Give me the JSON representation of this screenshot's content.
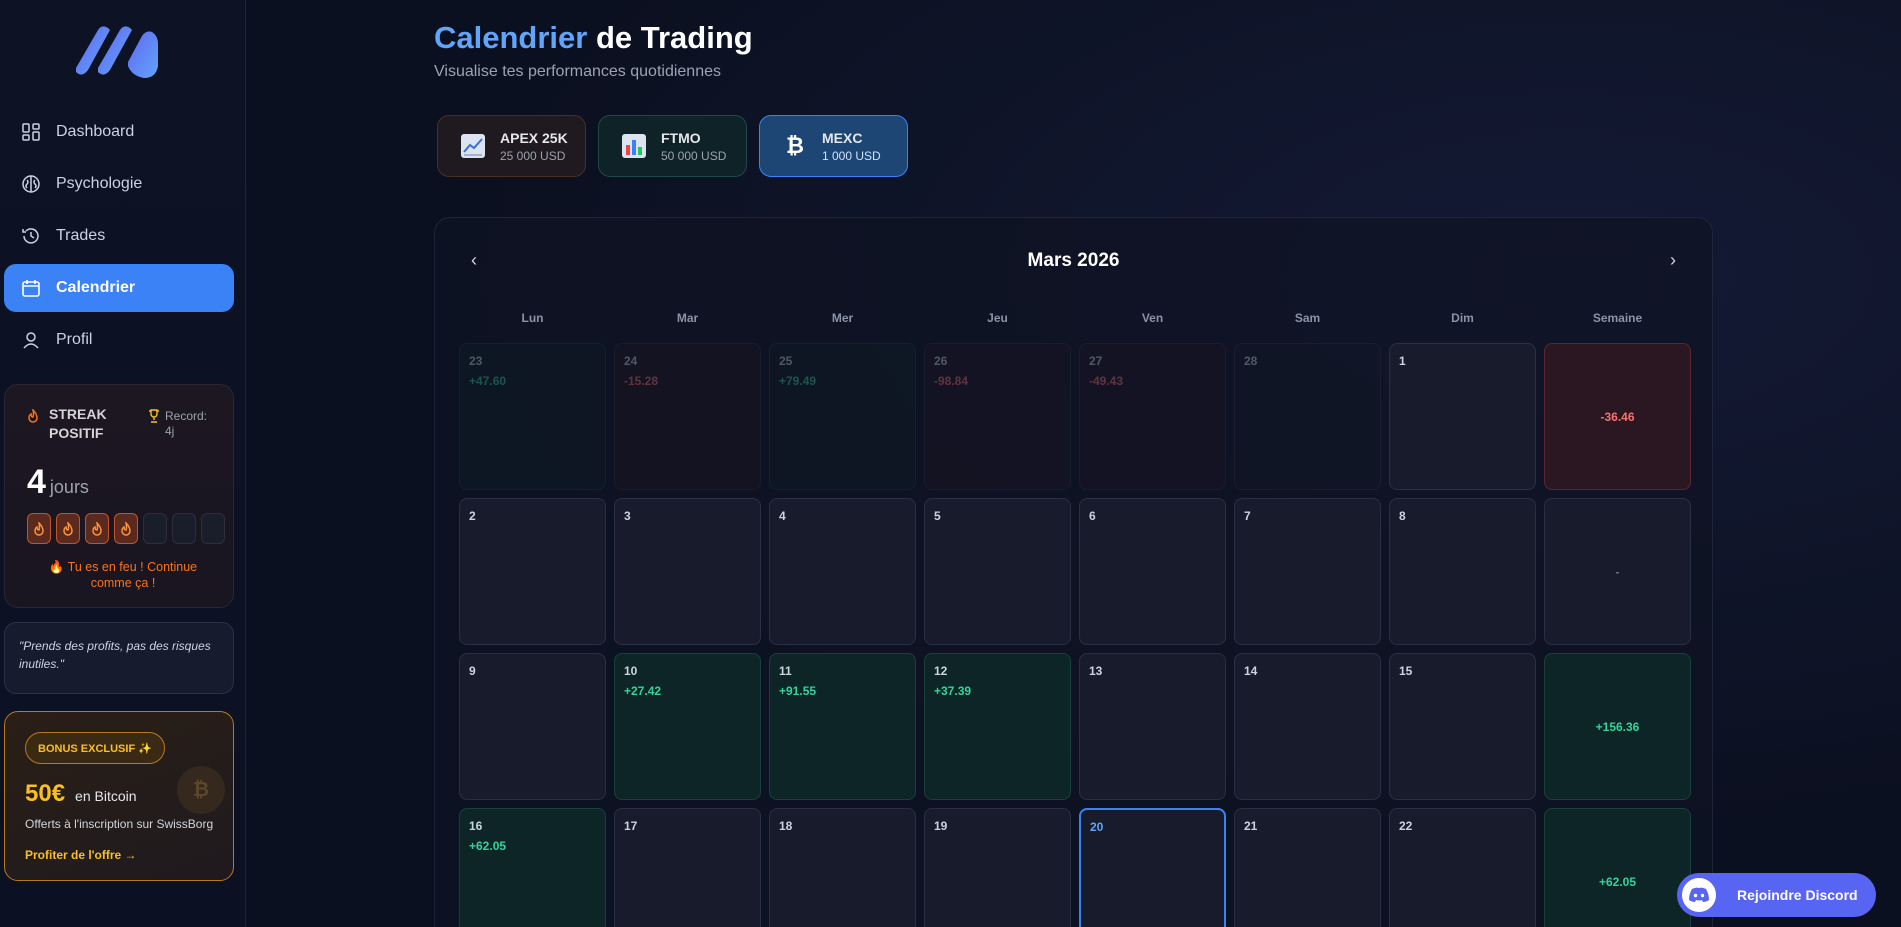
{
  "sidebar": {
    "nav": [
      {
        "label": "Dashboard",
        "icon": "dashboard-icon"
      },
      {
        "label": "Psychologie",
        "icon": "brain-icon"
      },
      {
        "label": "Trades",
        "icon": "history-icon"
      },
      {
        "label": "Calendrier",
        "icon": "calendar-icon",
        "active": true
      },
      {
        "label": "Profil",
        "icon": "user-icon"
      }
    ],
    "streak": {
      "title": "STREAK POSITIF",
      "record": "Record: 4j",
      "count": "4",
      "unit": "jours",
      "flames_on": 4,
      "flames_total": 7,
      "message": "🔥 Tu es en feu ! Continue comme ça !"
    },
    "quote": "\"Prends des profits, pas des risques inutiles.\"",
    "bonus": {
      "badge": "BONUS EXCLUSIF ✨",
      "amount": "50€",
      "amount_suffix": "en Bitcoin",
      "subtitle": "Offerts à l'inscription sur SwissBorg",
      "link": "Profiter de l'offre →"
    }
  },
  "header": {
    "title_highlight": "Calendrier",
    "title_rest": " de Trading",
    "subtitle": "Visualise tes performances quotidiennes"
  },
  "accounts": [
    {
      "name": "APEX 25K",
      "balance": "25 000 USD",
      "icon": "chart-line-icon",
      "variant": "apex"
    },
    {
      "name": "FTMO",
      "balance": "50 000 USD",
      "icon": "bar-chart-icon",
      "variant": "ftmo"
    },
    {
      "name": "MEXC",
      "balance": "1 000 USD",
      "icon": "bitcoin-icon",
      "variant": "mexc",
      "selected": true
    }
  ],
  "calendar": {
    "month": "Mars 2026",
    "prev": "‹",
    "next": "›",
    "headers": [
      "Lun",
      "Mar",
      "Mer",
      "Jeu",
      "Ven",
      "Sam",
      "Dim",
      "Semaine"
    ],
    "weeks": [
      {
        "days": [
          {
            "d": "23",
            "pnl": "+47.60",
            "other": true,
            "type": "win"
          },
          {
            "d": "24",
            "pnl": "-15.28",
            "other": true,
            "type": "loss"
          },
          {
            "d": "25",
            "pnl": "+79.49",
            "other": true,
            "type": "win"
          },
          {
            "d": "26",
            "pnl": "-98.84",
            "other": true,
            "type": "loss"
          },
          {
            "d": "27",
            "pnl": "-49.43",
            "other": true,
            "type": "loss"
          },
          {
            "d": "28",
            "pnl": "",
            "other": true,
            "type": ""
          },
          {
            "d": "1",
            "pnl": "",
            "type": ""
          }
        ],
        "week_total": "-36.46",
        "week_type": "loss"
      },
      {
        "days": [
          {
            "d": "2",
            "pnl": ""
          },
          {
            "d": "3",
            "pnl": ""
          },
          {
            "d": "4",
            "pnl": ""
          },
          {
            "d": "5",
            "pnl": ""
          },
          {
            "d": "6",
            "pnl": ""
          },
          {
            "d": "7",
            "pnl": ""
          },
          {
            "d": "8",
            "pnl": ""
          }
        ],
        "week_total": "-",
        "week_type": "neutral"
      },
      {
        "days": [
          {
            "d": "9",
            "pnl": ""
          },
          {
            "d": "10",
            "pnl": "+27.42",
            "type": "win"
          },
          {
            "d": "11",
            "pnl": "+91.55",
            "type": "win"
          },
          {
            "d": "12",
            "pnl": "+37.39",
            "type": "win"
          },
          {
            "d": "13",
            "pnl": ""
          },
          {
            "d": "14",
            "pnl": ""
          },
          {
            "d": "15",
            "pnl": ""
          }
        ],
        "week_total": "+156.36",
        "week_type": "win"
      },
      {
        "days": [
          {
            "d": "16",
            "pnl": "+62.05",
            "type": "win"
          },
          {
            "d": "17",
            "pnl": ""
          },
          {
            "d": "18",
            "pnl": ""
          },
          {
            "d": "19",
            "pnl": ""
          },
          {
            "d": "20",
            "pnl": "",
            "today": true
          },
          {
            "d": "21",
            "pnl": ""
          },
          {
            "d": "22",
            "pnl": ""
          }
        ],
        "week_total": "+62.05",
        "week_type": "win"
      }
    ]
  },
  "discord": {
    "label": "Rejoindre Discord",
    "icon": "discord-icon"
  },
  "colors": {
    "accent": "#3b82f6",
    "profit": "#34d399",
    "loss": "#f87171",
    "gold": "#fbbf24"
  }
}
